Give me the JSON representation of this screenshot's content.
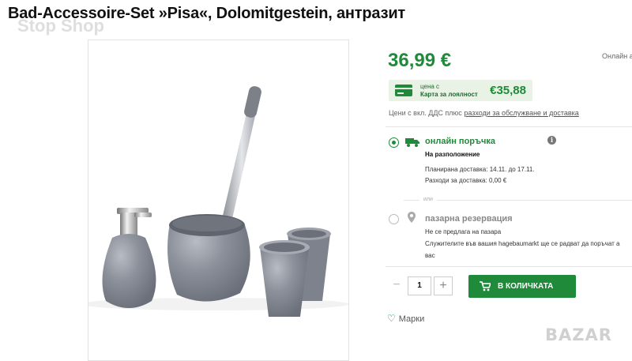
{
  "product": {
    "title": "Bad-Accessoire-Set »Pisa«, Dolomitgestein, антразит",
    "watermark": "Stop Shop"
  },
  "price": {
    "main": "36,99 €",
    "availability_hint": "Онлайн а",
    "loyalty_label_line1": "цена с",
    "loyalty_label_line2": "Карта за лоялност",
    "loyalty_price": "€35,88",
    "vat_text": "Цени с вкл. ДДС плюс ",
    "vat_link": "разходи за обслужване и доставка"
  },
  "delivery": {
    "online": {
      "title": "онлайн поръчка",
      "availability": "На разположение",
      "planned": "Планирана доставка: 14.11. до 17.11.",
      "cost": "Разходи за доставка: 0,00 €",
      "selected": true
    },
    "or_label": "или",
    "store": {
      "title": "пазарна резервация",
      "line1": "Не се предлага на пазара",
      "line2": "Служителите във вашия hagebaumarkt ще се радват да поръчат а",
      "line3": "вас",
      "selected": false
    }
  },
  "purchase": {
    "minus": "−",
    "quantity": "1",
    "plus": "+",
    "cart_label": "В КОЛИЧКАТА"
  },
  "wishlist": {
    "label": "Марки"
  },
  "brand_watermark": "BAZAR",
  "colors": {
    "accent": "#1f8a3a",
    "loyalty_bg": "#e8f3e6",
    "product_gray": "#8a8f99"
  },
  "icons": [
    "truck-icon",
    "info-icon",
    "pin-icon",
    "cart-icon",
    "heart-icon",
    "card-icon"
  ]
}
